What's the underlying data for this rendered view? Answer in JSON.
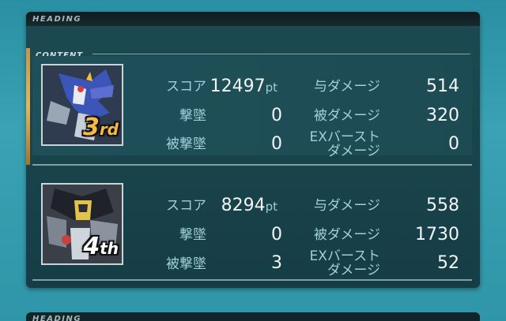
{
  "panel": {
    "heading": "HEADING",
    "content_label": "CONTENT"
  },
  "labels": {
    "score": "スコア",
    "kills": "撃墜",
    "deaths": "被撃墜",
    "dmg_dealt": "与ダメージ",
    "dmg_taken": "被ダメージ",
    "ex_burst_line1": "EXバースト",
    "ex_burst_line2": "ダメージ",
    "pt_unit": "pt"
  },
  "players": [
    {
      "rank_num": "3",
      "rank_suffix": "rd",
      "score": "12497",
      "kills": "0",
      "deaths": "0",
      "dmg_dealt": "514",
      "dmg_taken": "320",
      "ex_burst_dmg": "0"
    },
    {
      "rank_num": "4",
      "rank_suffix": "th",
      "score": "8294",
      "kills": "0",
      "deaths": "3",
      "dmg_dealt": "558",
      "dmg_taken": "1730",
      "ex_burst_dmg": "52"
    }
  ],
  "next_panel": {
    "heading": "HEADING"
  },
  "colors": {
    "background": "#3aa2b4",
    "panel": "#1d4a52",
    "label": "#9fcfd8",
    "value": "#f2f6f7",
    "gold": "#e7b45d"
  }
}
